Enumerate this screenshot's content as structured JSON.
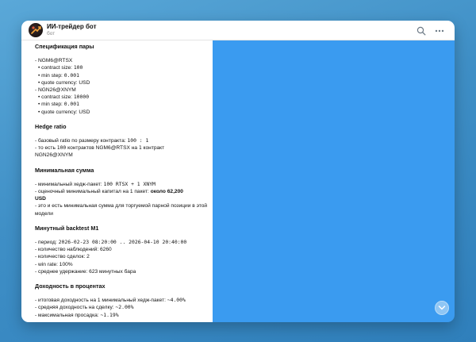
{
  "header": {
    "title": "ИИ-трейдер бот",
    "subtitle": "бот"
  },
  "icons": {
    "search": "search-icon",
    "more": "more-icon",
    "scroll_down": "chevron-down-icon"
  },
  "colors": {
    "chat_background": "#3a9bf0",
    "desktop_background": "#4a98cf"
  },
  "message": {
    "spec_title": "Спецификация пары",
    "pair1_name": "- NGM6@RTSX",
    "pair1_contract_label": "contract size: ",
    "pair1_contract_val": "100",
    "pair1_step_label": "min step: ",
    "pair1_step_val": "0.001",
    "pair1_quote": "quote currency: USD",
    "pair2_name": "- NGN26@XNYM",
    "pair2_contract_label": "contract size: ",
    "pair2_contract_val": "10000",
    "pair2_step_label": "min step: ",
    "pair2_step_val": "0.001",
    "pair2_quote": "quote currency: USD",
    "hedge_title": "Hedge ratio",
    "hedge_l1_text": "- базовый ratio по размеру контракта: ",
    "hedge_l1_mono": "100 : 1",
    "hedge_l2_a": "- то есть ",
    "hedge_l2_b": "100",
    "hedge_l2_c": " контрактов ",
    "hedge_l2_d": "NGM6@RTSX",
    "hedge_l2_e": " на ",
    "hedge_l2_f": "1",
    "hedge_l2_g": " контракт",
    "hedge_l3": "NGN26@XNYM",
    "minsum_title": "Минимальная сумма",
    "minsum_l1_text": "- минимальный хедж-пакет: ",
    "minsum_l1_mono": "100 RTSX + 1 XNYM",
    "minsum_l2_text": "- оценочный минимальный капитал на 1 пакет: ",
    "minsum_l2_bold": "около 62,200",
    "minsum_l3_bold": "USD",
    "minsum_l4": "- это и есть минимальная сумма для торгуемой парной позиции в этой модели",
    "backtest_title": "Минутный backtest M1",
    "bt_period_label": "- период: ",
    "bt_period_val": "2026-02-23 08:20:00 .. 2026-04-10 20:40:00",
    "bt_obs": "- количество наблюдений: 6260",
    "bt_trades": "- количество сделок: 2",
    "bt_winrate": "- win rate: 100%",
    "bt_hold": "- среднее удержание: 623 минутных бара",
    "returns_title": "Доходность в процентах",
    "ret_l1_text": "- итоговая доходность на 1 минимальный хедж-пакет: ",
    "ret_l1_mono": "~4.00%",
    "ret_l2_text": "- средняя доходность на сделку: ",
    "ret_l2_mono": "~2.00%",
    "ret_l3_text": "- максимальная просадка: ",
    "ret_l3_mono": "~1.19%"
  }
}
